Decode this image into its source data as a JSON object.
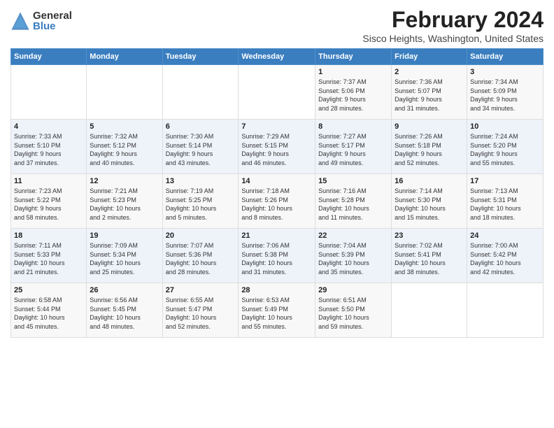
{
  "logo": {
    "general": "General",
    "blue": "Blue"
  },
  "title": "February 2024",
  "subtitle": "Sisco Heights, Washington, United States",
  "days_of_week": [
    "Sunday",
    "Monday",
    "Tuesday",
    "Wednesday",
    "Thursday",
    "Friday",
    "Saturday"
  ],
  "weeks": [
    [
      {
        "day": "",
        "info": ""
      },
      {
        "day": "",
        "info": ""
      },
      {
        "day": "",
        "info": ""
      },
      {
        "day": "",
        "info": ""
      },
      {
        "day": "1",
        "info": "Sunrise: 7:37 AM\nSunset: 5:06 PM\nDaylight: 9 hours\nand 28 minutes."
      },
      {
        "day": "2",
        "info": "Sunrise: 7:36 AM\nSunset: 5:07 PM\nDaylight: 9 hours\nand 31 minutes."
      },
      {
        "day": "3",
        "info": "Sunrise: 7:34 AM\nSunset: 5:09 PM\nDaylight: 9 hours\nand 34 minutes."
      }
    ],
    [
      {
        "day": "4",
        "info": "Sunrise: 7:33 AM\nSunset: 5:10 PM\nDaylight: 9 hours\nand 37 minutes."
      },
      {
        "day": "5",
        "info": "Sunrise: 7:32 AM\nSunset: 5:12 PM\nDaylight: 9 hours\nand 40 minutes."
      },
      {
        "day": "6",
        "info": "Sunrise: 7:30 AM\nSunset: 5:14 PM\nDaylight: 9 hours\nand 43 minutes."
      },
      {
        "day": "7",
        "info": "Sunrise: 7:29 AM\nSunset: 5:15 PM\nDaylight: 9 hours\nand 46 minutes."
      },
      {
        "day": "8",
        "info": "Sunrise: 7:27 AM\nSunset: 5:17 PM\nDaylight: 9 hours\nand 49 minutes."
      },
      {
        "day": "9",
        "info": "Sunrise: 7:26 AM\nSunset: 5:18 PM\nDaylight: 9 hours\nand 52 minutes."
      },
      {
        "day": "10",
        "info": "Sunrise: 7:24 AM\nSunset: 5:20 PM\nDaylight: 9 hours\nand 55 minutes."
      }
    ],
    [
      {
        "day": "11",
        "info": "Sunrise: 7:23 AM\nSunset: 5:22 PM\nDaylight: 9 hours\nand 58 minutes."
      },
      {
        "day": "12",
        "info": "Sunrise: 7:21 AM\nSunset: 5:23 PM\nDaylight: 10 hours\nand 2 minutes."
      },
      {
        "day": "13",
        "info": "Sunrise: 7:19 AM\nSunset: 5:25 PM\nDaylight: 10 hours\nand 5 minutes."
      },
      {
        "day": "14",
        "info": "Sunrise: 7:18 AM\nSunset: 5:26 PM\nDaylight: 10 hours\nand 8 minutes."
      },
      {
        "day": "15",
        "info": "Sunrise: 7:16 AM\nSunset: 5:28 PM\nDaylight: 10 hours\nand 11 minutes."
      },
      {
        "day": "16",
        "info": "Sunrise: 7:14 AM\nSunset: 5:30 PM\nDaylight: 10 hours\nand 15 minutes."
      },
      {
        "day": "17",
        "info": "Sunrise: 7:13 AM\nSunset: 5:31 PM\nDaylight: 10 hours\nand 18 minutes."
      }
    ],
    [
      {
        "day": "18",
        "info": "Sunrise: 7:11 AM\nSunset: 5:33 PM\nDaylight: 10 hours\nand 21 minutes."
      },
      {
        "day": "19",
        "info": "Sunrise: 7:09 AM\nSunset: 5:34 PM\nDaylight: 10 hours\nand 25 minutes."
      },
      {
        "day": "20",
        "info": "Sunrise: 7:07 AM\nSunset: 5:36 PM\nDaylight: 10 hours\nand 28 minutes."
      },
      {
        "day": "21",
        "info": "Sunrise: 7:06 AM\nSunset: 5:38 PM\nDaylight: 10 hours\nand 31 minutes."
      },
      {
        "day": "22",
        "info": "Sunrise: 7:04 AM\nSunset: 5:39 PM\nDaylight: 10 hours\nand 35 minutes."
      },
      {
        "day": "23",
        "info": "Sunrise: 7:02 AM\nSunset: 5:41 PM\nDaylight: 10 hours\nand 38 minutes."
      },
      {
        "day": "24",
        "info": "Sunrise: 7:00 AM\nSunset: 5:42 PM\nDaylight: 10 hours\nand 42 minutes."
      }
    ],
    [
      {
        "day": "25",
        "info": "Sunrise: 6:58 AM\nSunset: 5:44 PM\nDaylight: 10 hours\nand 45 minutes."
      },
      {
        "day": "26",
        "info": "Sunrise: 6:56 AM\nSunset: 5:45 PM\nDaylight: 10 hours\nand 48 minutes."
      },
      {
        "day": "27",
        "info": "Sunrise: 6:55 AM\nSunset: 5:47 PM\nDaylight: 10 hours\nand 52 minutes."
      },
      {
        "day": "28",
        "info": "Sunrise: 6:53 AM\nSunset: 5:49 PM\nDaylight: 10 hours\nand 55 minutes."
      },
      {
        "day": "29",
        "info": "Sunrise: 6:51 AM\nSunset: 5:50 PM\nDaylight: 10 hours\nand 59 minutes."
      },
      {
        "day": "",
        "info": ""
      },
      {
        "day": "",
        "info": ""
      }
    ]
  ]
}
